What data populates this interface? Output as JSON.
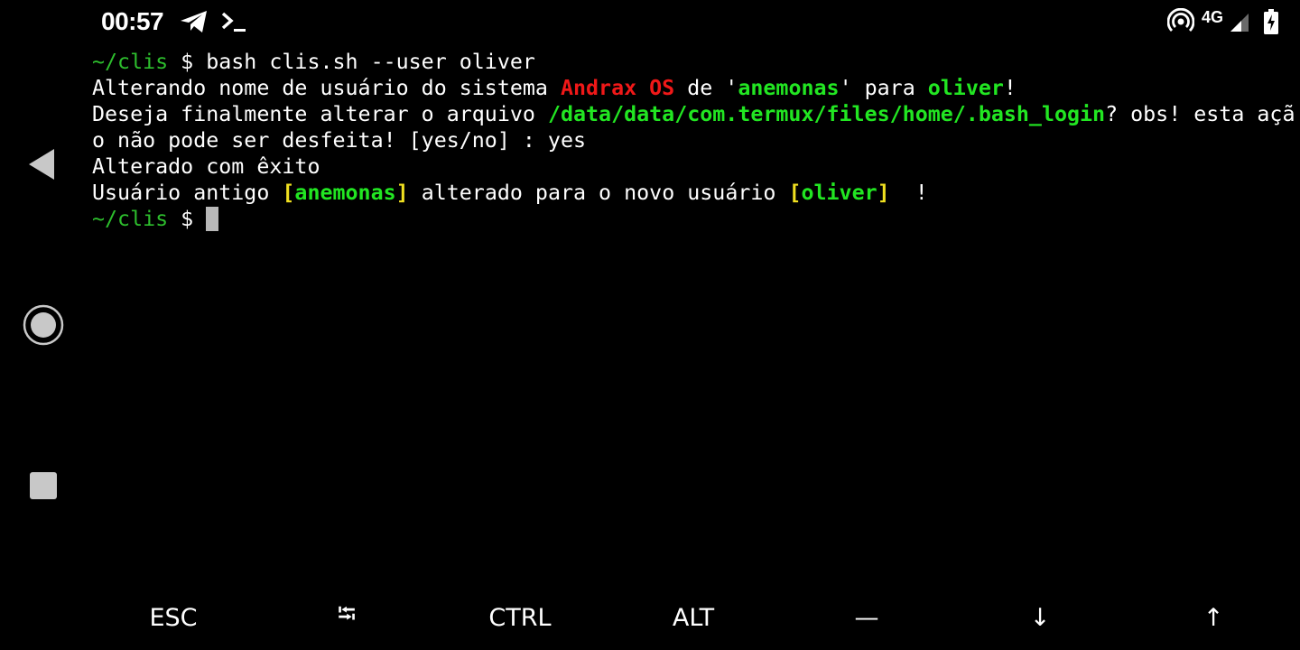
{
  "status_bar": {
    "time": "00:57",
    "network_type": "4G",
    "icons": [
      "telegram-icon",
      "terminal-prompt-icon",
      "hotspot-icon",
      "signal-icon",
      "battery-charging-icon"
    ]
  },
  "terminal": {
    "line1": {
      "prompt_dir": "~/clis",
      "prompt_symbol": " $ ",
      "command": "bash clis.sh --user oliver"
    },
    "line2": {
      "t1": "Alterando nome de usuário do sistema ",
      "os_name": "Andrax OS",
      "t2": " de '",
      "old_user": "anemonas",
      "t3": "' para ",
      "new_user": "oliver",
      "t4": "!"
    },
    "line3": {
      "t1": "Deseja finalmente alterar o arquivo ",
      "file_path": "/data/data/com.termux/files/home/.bash_login",
      "t2": "? obs! esta açã"
    },
    "line4": {
      "text": "o não pode ser desfeita! [yes/no] : yes"
    },
    "line5": {
      "text": "Alterado com êxito"
    },
    "line6": {
      "t1": "Usuário antigo ",
      "b1_open": "[",
      "old_user": "anemonas",
      "b1_close": "]",
      "t2": " alterado para o novo usuário ",
      "b2_open": "[",
      "new_user": "oliver",
      "b2_close": "]",
      "t3": "  !"
    },
    "line7": {
      "prompt_dir": "~/clis",
      "prompt_symbol": " $ "
    }
  },
  "extra_keys": {
    "esc": "ESC",
    "tab": "⭾",
    "ctrl": "CTRL",
    "alt": "ALT",
    "dash": "—",
    "down": "↓",
    "up": "↑"
  },
  "navigation": {
    "icons": [
      "back-icon",
      "home-icon",
      "recents-icon"
    ]
  },
  "colors": {
    "prompt_green": "#2dbe2d",
    "highlight_green": "#22e622",
    "red": "#f01818",
    "yellow": "#f0e020",
    "background": "#000000"
  }
}
